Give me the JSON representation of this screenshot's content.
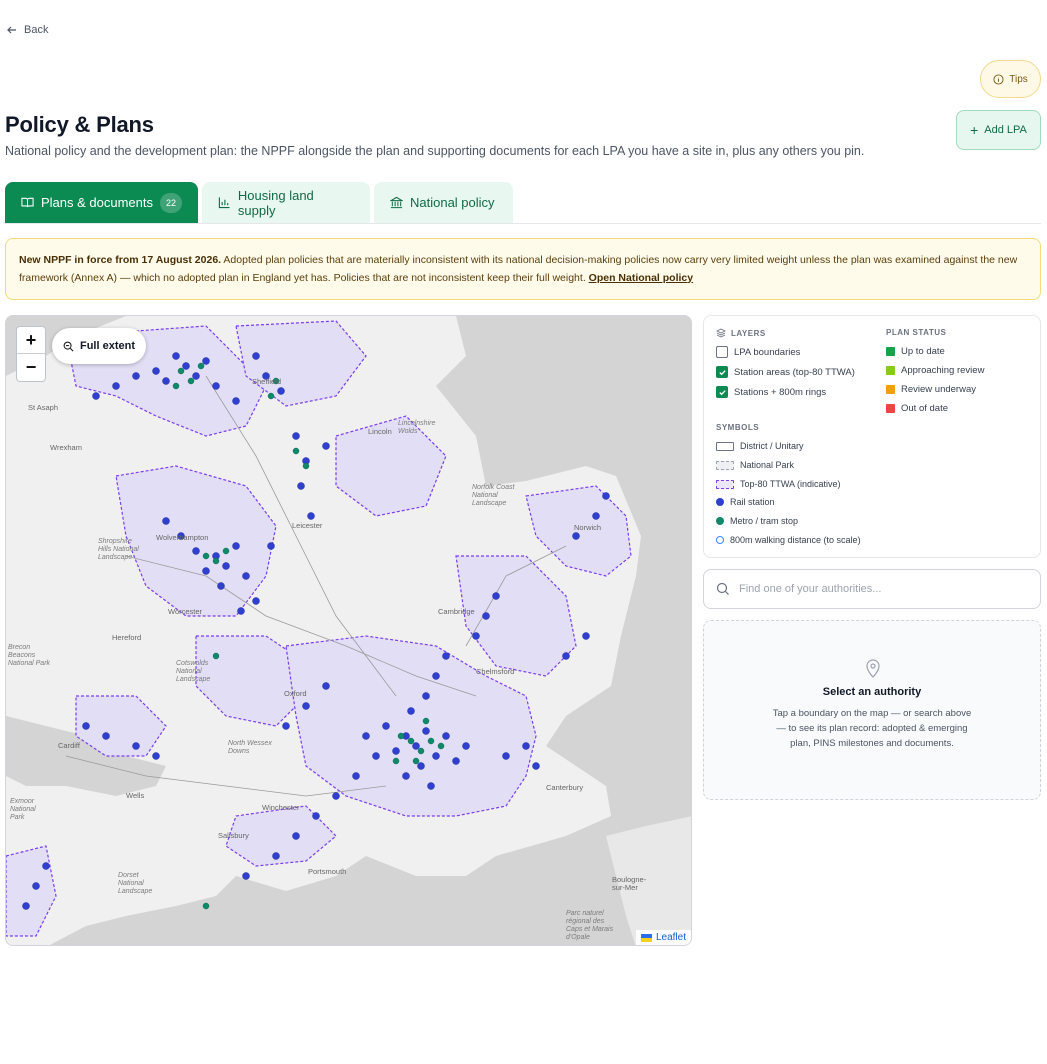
{
  "nav": {
    "back_label": "Back"
  },
  "header": {
    "title": "Policy & Plans",
    "subtitle": "National policy and the development plan: the NPPF alongside the plan and supporting documents for each LPA you have a site in, plus any others you pin.",
    "tips_label": "Tips",
    "add_lpa_label": "Add LPA"
  },
  "tabs": [
    {
      "label": "Plans & documents",
      "count": "22",
      "icon": "book-open-icon",
      "active": true
    },
    {
      "label": "Housing land supply",
      "icon": "bar-chart-icon",
      "active": false
    },
    {
      "label": "National policy",
      "icon": "bank-icon",
      "active": false
    }
  ],
  "banner": {
    "lead": "New NPPF in force from 17 August 2026.",
    "body": " Adopted plan policies that are materially inconsistent with its national decision-making policies now carry very limited weight unless the plan was examined against the new framework (Annex A) — which no adopted plan in England yet has. Policies that are not inconsistent keep their full weight. ",
    "link": "Open National policy"
  },
  "map": {
    "zoom_in": "+",
    "zoom_out": "−",
    "full_extent_label": "Full extent",
    "attribution": "Leaflet",
    "colors": {
      "rail_station": "#2f3fd0",
      "metro_stop": "#0e8a6a",
      "ttwa_boundary": "#7a3cf0"
    },
    "places": [
      "St Asaph",
      "Wrexham",
      "Sheffield",
      "Lincoln",
      "Leicester",
      "Norwich",
      "Wolverhampton",
      "Worcester",
      "Hereford",
      "Cambridge",
      "Oxford",
      "Chelmsford",
      "Cardiff",
      "Wells",
      "Salisbury",
      "Winchester",
      "Canterbury",
      "Portsmouth",
      "Exmoor National Park",
      "Dorset National Landscape",
      "North Wessex Downs",
      "Norfolk Coast National Landscape",
      "Lincolnshire Wolds",
      "Shropshire Hills National Landscape",
      "Brecon Beacons National Park",
      "Cotswolds National Landscape",
      "Boulogne-sur-Mer",
      "Parc naturel régional des Caps et Marais d'Opale"
    ]
  },
  "legend": {
    "layers_heading": "LAYERS",
    "layers": [
      {
        "label": "LPA boundaries",
        "checked": false
      },
      {
        "label": "Station areas (top-80 TTWA)",
        "checked": true
      },
      {
        "label": "Stations + 800m rings",
        "checked": true
      }
    ],
    "status_heading": "PLAN STATUS",
    "statuses": [
      {
        "label": "Up to date",
        "color": "#16a34a"
      },
      {
        "label": "Approaching review",
        "color": "#84cc16"
      },
      {
        "label": "Review underway",
        "color": "#f59e0b"
      },
      {
        "label": "Out of date",
        "color": "#ef4444"
      }
    ],
    "symbols_heading": "SYMBOLS",
    "symbols": [
      {
        "label": "District / Unitary"
      },
      {
        "label": "National Park"
      },
      {
        "label": "Top-80 TTWA (indicative)"
      },
      {
        "label": "Rail station"
      },
      {
        "label": "Metro / tram stop"
      },
      {
        "label": "800m walking distance (to scale)"
      }
    ]
  },
  "search": {
    "placeholder": "Find one of your authorities..."
  },
  "select_card": {
    "title": "Select an authority",
    "description": "Tap a boundary on the map — or search above — to see its plan record: adopted & emerging plan, PINS milestones and documents."
  }
}
